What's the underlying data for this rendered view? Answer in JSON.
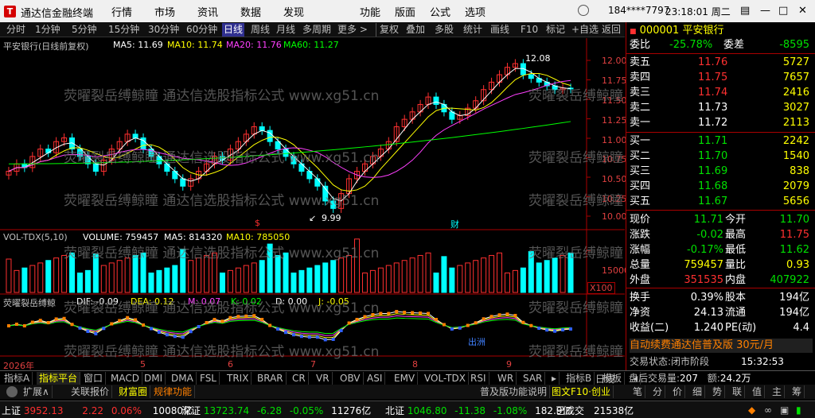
{
  "titlebar": {
    "app_title": "通达信金融终端",
    "menus": [
      "行情",
      "市场",
      "资讯",
      "数据",
      "发现",
      "功能",
      "版面",
      "公式",
      "选项"
    ],
    "user": "184****7797",
    "time": "23:18:01 周二"
  },
  "toolbar": {
    "items": [
      "分时",
      "1分钟",
      "5分钟",
      "15分钟",
      "30分钟",
      "60分钟",
      "日线",
      "周线",
      "月线",
      "多周期",
      "更多 >",
      "复权",
      "叠加",
      "多股",
      "统计",
      "画线",
      "F10",
      "标记",
      "+自选",
      "返回"
    ],
    "active": "日线"
  },
  "price_chart": {
    "title": "平安银行(日线前复权)",
    "ma_labels": [
      {
        "text": "MA5: 11.69",
        "color": "#ffffff"
      },
      {
        "text": "MA10: 11.74",
        "color": "#ffff00"
      },
      {
        "text": "MA20: 11.76",
        "color": "#ff40ff"
      },
      {
        "text": "MA60: 11.27",
        "color": "#00ff00"
      }
    ],
    "high_label": "12.08",
    "low_label": "9.99",
    "axis": [
      "12.00",
      "11.75",
      "11.50",
      "11.25",
      "11.00",
      "10.75",
      "10.50",
      "10.25",
      "10.00"
    ],
    "markers": [
      "$",
      "财"
    ]
  },
  "chart_data": [
    {
      "type": "candlestick",
      "title": "平安银行(日线前复权)",
      "ylim": [
        9.9,
        12.2
      ],
      "x_labels": [
        "2026年",
        "5",
        "6",
        "7",
        "8",
        "9"
      ],
      "values_close": [
        10.6,
        10.7,
        10.65,
        10.8,
        10.9,
        10.85,
        11.0,
        11.05,
        10.9,
        10.8,
        10.7,
        10.6,
        10.75,
        10.9,
        11.0,
        11.1,
        11.05,
        10.9,
        10.8,
        10.7,
        10.6,
        10.5,
        10.4,
        10.5,
        10.6,
        10.7,
        10.8,
        10.75,
        10.9,
        11.0,
        11.1,
        11.2,
        11.15,
        11.0,
        10.9,
        10.8,
        10.7,
        10.6,
        10.5,
        10.4,
        10.2,
        10.1,
        10.3,
        10.5,
        10.6,
        10.7,
        10.8,
        10.9,
        11.0,
        11.2,
        11.3,
        11.4,
        11.5,
        11.6,
        11.5,
        11.4,
        11.3,
        11.35,
        11.45,
        11.55,
        11.7,
        11.8,
        11.9,
        12.0,
        12.05,
        11.9,
        11.85,
        11.8,
        11.75,
        11.7,
        11.72,
        11.71
      ],
      "ma60_end": 11.27
    },
    {
      "type": "bar",
      "title": "VOL-TDX(5,10)",
      "series": [
        {
          "name": "VOLUME",
          "values": [
            759457
          ]
        },
        {
          "name": "MA5",
          "values": [
            814320
          ]
        },
        {
          "name": "MA10",
          "values": [
            785050
          ]
        }
      ],
      "ylim": [
        0,
        20000
      ],
      "axis_label": "15000",
      "unit": "X100"
    },
    {
      "type": "line",
      "title": "荧曜裂岳缚鲸",
      "series": [
        {
          "name": "DIF",
          "values": [
            -0.09
          ]
        },
        {
          "name": "DEA",
          "values": [
            0.12
          ]
        },
        {
          "name": "M",
          "values": [
            0.07
          ]
        },
        {
          "name": "K",
          "values": [
            0.02
          ]
        },
        {
          "name": "D",
          "values": [
            0.0
          ]
        },
        {
          "name": "J",
          "values": [
            -0.05
          ]
        }
      ]
    }
  ],
  "volume_chart": {
    "title": "VOL-TDX(5,10)",
    "labels": [
      {
        "text": "VOLUME: 759457",
        "color": "#ffffff"
      },
      {
        "text": "MA5: 814320",
        "color": "#ffffff"
      },
      {
        "text": "MA10: 785050",
        "color": "#ffff00"
      }
    ],
    "axis": "15000",
    "unit": "X100"
  },
  "indicator_chart": {
    "title": "荧曜裂岳缚鲸",
    "labels": [
      {
        "text": "DIF: -0.09",
        "color": "#ffffff"
      },
      {
        "text": "DEA: 0.12",
        "color": "#ffff00"
      },
      {
        "text": "M: 0.07",
        "color": "#ff40ff"
      },
      {
        "text": "K: 0.02",
        "color": "#00ff00"
      },
      {
        "text": "D: 0.00",
        "color": "#ffffff"
      },
      {
        "text": "J: -0.05",
        "color": "#ffff00"
      }
    ],
    "note": "出洲"
  },
  "x_axis": [
    "2026年",
    "5",
    "6",
    "7",
    "8",
    "9"
  ],
  "watermark": "荧曜裂岳缚鲸瞳 通达信选股指标公式 www.xg51.cn",
  "quote": {
    "code": "000001",
    "name": "平安银行",
    "weibi_label": "委比",
    "weibi": "-25.78%",
    "weicha_label": "委差",
    "weicha": "-8595",
    "asks": [
      {
        "label": "卖五",
        "price": "11.76",
        "vol": "5727"
      },
      {
        "label": "卖四",
        "price": "11.75",
        "vol": "7657"
      },
      {
        "label": "卖三",
        "price": "11.74",
        "vol": "2416"
      },
      {
        "label": "卖二",
        "price": "11.73",
        "vol": "3027"
      },
      {
        "label": "卖一",
        "price": "11.72",
        "vol": "2113"
      }
    ],
    "bids": [
      {
        "label": "买一",
        "price": "11.71",
        "vol": "2242"
      },
      {
        "label": "买二",
        "price": "11.70",
        "vol": "1540"
      },
      {
        "label": "买三",
        "price": "11.69",
        "vol": "838"
      },
      {
        "label": "买四",
        "price": "11.68",
        "vol": "2079"
      },
      {
        "label": "买五",
        "price": "11.67",
        "vol": "5656"
      }
    ],
    "stats": [
      {
        "l1": "现价",
        "v1": "11.71",
        "c1": "#00e000",
        "l2": "今开",
        "v2": "11.70",
        "c2": "#00e000"
      },
      {
        "l1": "涨跌",
        "v1": "-0.02",
        "c1": "#00e000",
        "l2": "最高",
        "v2": "11.75",
        "c2": "#ff3030"
      },
      {
        "l1": "涨幅",
        "v1": "-0.17%",
        "c1": "#00e000",
        "l2": "最低",
        "v2": "11.62",
        "c2": "#00e000"
      },
      {
        "l1": "总量",
        "v1": "759457",
        "c1": "#ffff00",
        "l2": "量比",
        "v2": "0.93",
        "c2": "#ffff00"
      },
      {
        "l1": "外盘",
        "v1": "351535",
        "c1": "#ff3030",
        "l2": "内盘",
        "v2": "407922",
        "c2": "#00e000"
      }
    ],
    "fin": [
      {
        "l1": "换手",
        "v1": "0.39%",
        "l2": "股本",
        "v2": "194亿"
      },
      {
        "l1": "净资",
        "v1": "24.13",
        "l2": "流通",
        "v2": "194亿"
      },
      {
        "l1": "收益(二)",
        "v1": "1.240",
        "l2": "PE(动)",
        "v2": "4.4"
      }
    ],
    "ad": "自动续费通达信普及版 30元/月",
    "trade_status_label": "交易状态:",
    "trade_status": "闭市阶段",
    "trade_time": "15:32:53",
    "after_label": "盘后交易量:",
    "after_vol": "207",
    "amount_label": "额:",
    "amount": "24.2万",
    "tabs": [
      "笔",
      "分",
      "价",
      "细",
      "势",
      "联",
      "值",
      "主",
      "筹"
    ]
  },
  "indicator_tabs": {
    "items": [
      "指标A",
      "指标平台",
      "窗口",
      "MACD",
      "DMI",
      "DMA",
      "FSL",
      "TRIX",
      "BRAR",
      "CR",
      "VR",
      "OBV",
      "ASI",
      "EMV",
      "VOL-TDX",
      "RSI",
      "WR",
      "SAR",
      "▸",
      "指标B",
      "模板",
      "◂"
    ],
    "active": "指标平台",
    "period": "日线"
  },
  "bottom2": {
    "items": [
      "扩展∧",
      "关联报价",
      "财富圈",
      "规律功能"
    ],
    "right": "普及版功能说明",
    "f10": "图文F10·创业"
  },
  "status": {
    "idx1_name": "上证",
    "idx1_val": "3952.13",
    "idx1_chg": "2.22",
    "idx1_pct": "0.06%",
    "idx1_amt": "10080亿",
    "idx2_name": "深证",
    "idx2_val": "13723.74",
    "idx2_chg": "-6.28",
    "idx2_pct": "-0.05%",
    "idx2_amt": "11276亿",
    "idx3_name": "北证",
    "idx3_val": "1046.80",
    "idx3_chg": "-11.38",
    "idx3_pct": "-1.08%",
    "idx3_amt": "182.9亿",
    "flag": "已成交",
    "total": "21538亿"
  }
}
